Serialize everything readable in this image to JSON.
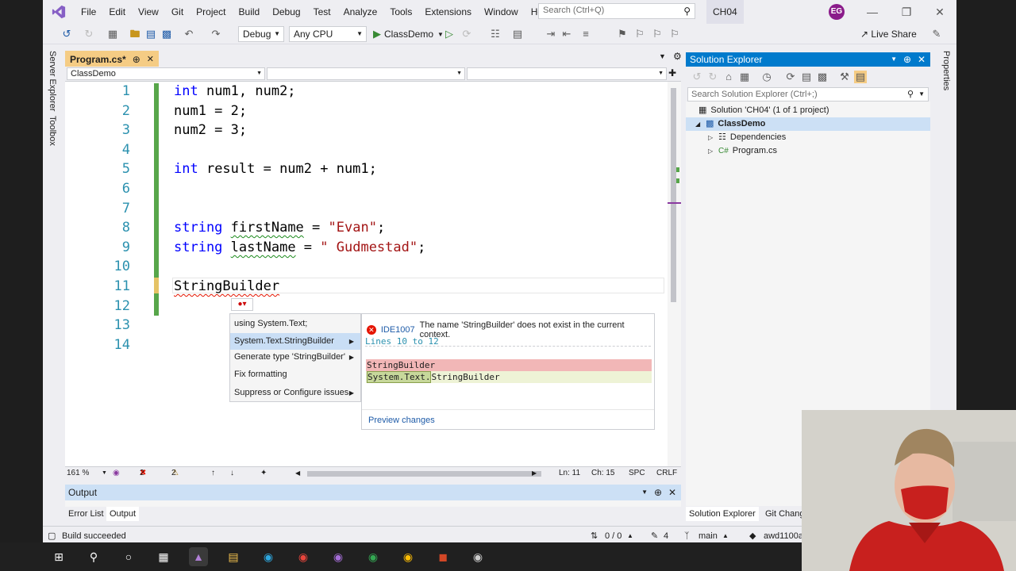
{
  "menubar": {
    "items": [
      "File",
      "Edit",
      "View",
      "Git",
      "Project",
      "Build",
      "Debug",
      "Test",
      "Analyze",
      "Tools",
      "Extensions",
      "Window",
      "Help"
    ],
    "search_placeholder": "Search (Ctrl+Q)",
    "solution_name": "CH04",
    "user_initials": "EG"
  },
  "toolbar": {
    "config": "Debug",
    "platform": "Any CPU",
    "run_target": "ClassDemo",
    "live_share": "Live Share"
  },
  "side_tabs": [
    "Server Explorer",
    "Toolbox"
  ],
  "right_side_tabs": [
    "Properties"
  ],
  "editor": {
    "tab_title": "Program.cs*",
    "nav_project": "ClassDemo",
    "lines": [
      {
        "n": "1",
        "code": "int num1, num2;"
      },
      {
        "n": "2",
        "code": "num1 = 2;"
      },
      {
        "n": "3",
        "code": "num2 = 3;"
      },
      {
        "n": "4",
        "code": ""
      },
      {
        "n": "5",
        "code": "int result = num2 + num1;"
      },
      {
        "n": "6",
        "code": ""
      },
      {
        "n": "7",
        "code": ""
      },
      {
        "n": "8",
        "code": "string firstName = \"Evan\";"
      },
      {
        "n": "9",
        "code": "string lastName = \" Gudmestad\";"
      },
      {
        "n": "10",
        "code": ""
      },
      {
        "n": "11",
        "code": "StringBuilder"
      },
      {
        "n": "12",
        "code": ""
      },
      {
        "n": "13",
        "code": ""
      },
      {
        "n": "14",
        "code": ""
      }
    ],
    "tokens": {
      "l1_kw": "int",
      "l1_rest": " num1, num2;",
      "l5_kw": "int",
      "l5_rest": " result = num2 + num1;",
      "l8_kw": "string",
      "l8_var": "firstName",
      "l8_eq": " = ",
      "l8_str": "\"Evan\"",
      "l8_end": ";",
      "l9_kw": "string",
      "l9_var": "lastName",
      "l9_eq": " = ",
      "l9_str": "\" Gudmestad\"",
      "l9_end": ";"
    }
  },
  "quick_actions": {
    "items": [
      "using System.Text;",
      "System.Text.StringBuilder",
      "Generate type 'StringBuilder'",
      "Fix formatting",
      "Suppress or Configure issues"
    ],
    "error_code": "IDE1007",
    "error_message": "The name 'StringBuilder' does not exist in the current context.",
    "lines_label": "Lines 10 to 12",
    "removed": "StringBuilder",
    "added_prefix": "System.Text.",
    "added_rest": "StringBuilder",
    "preview_link": "Preview changes"
  },
  "editor_status": {
    "zoom": "161 %",
    "errors": "2",
    "warnings": "2",
    "line": "Ln: 11",
    "col": "Ch: 15",
    "spc": "SPC",
    "eol": "CRLF"
  },
  "output": {
    "title": "Output",
    "tabs": [
      "Error List",
      "Output"
    ]
  },
  "solution_explorer": {
    "title": "Solution Explorer",
    "search_placeholder": "Search Solution Explorer (Ctrl+;)",
    "solution": "Solution 'CH04' (1 of 1 project)",
    "project": "ClassDemo",
    "dependencies": "Dependencies",
    "file": "Program.cs",
    "bottom_tabs": [
      "Solution Explorer",
      "Git Chang"
    ]
  },
  "statusbar": {
    "message": "Build succeeded",
    "sync": "0 / 0",
    "edits": "4",
    "branch": "main",
    "repo": "awd1100a"
  },
  "colors": {
    "accent": "#007acc",
    "doc_tab": "#f5cc84",
    "change_green": "#57a64a",
    "change_yellow": "#e5c365",
    "keyword": "#0000ff",
    "string": "#a31515",
    "line_number": "#2b91af"
  }
}
